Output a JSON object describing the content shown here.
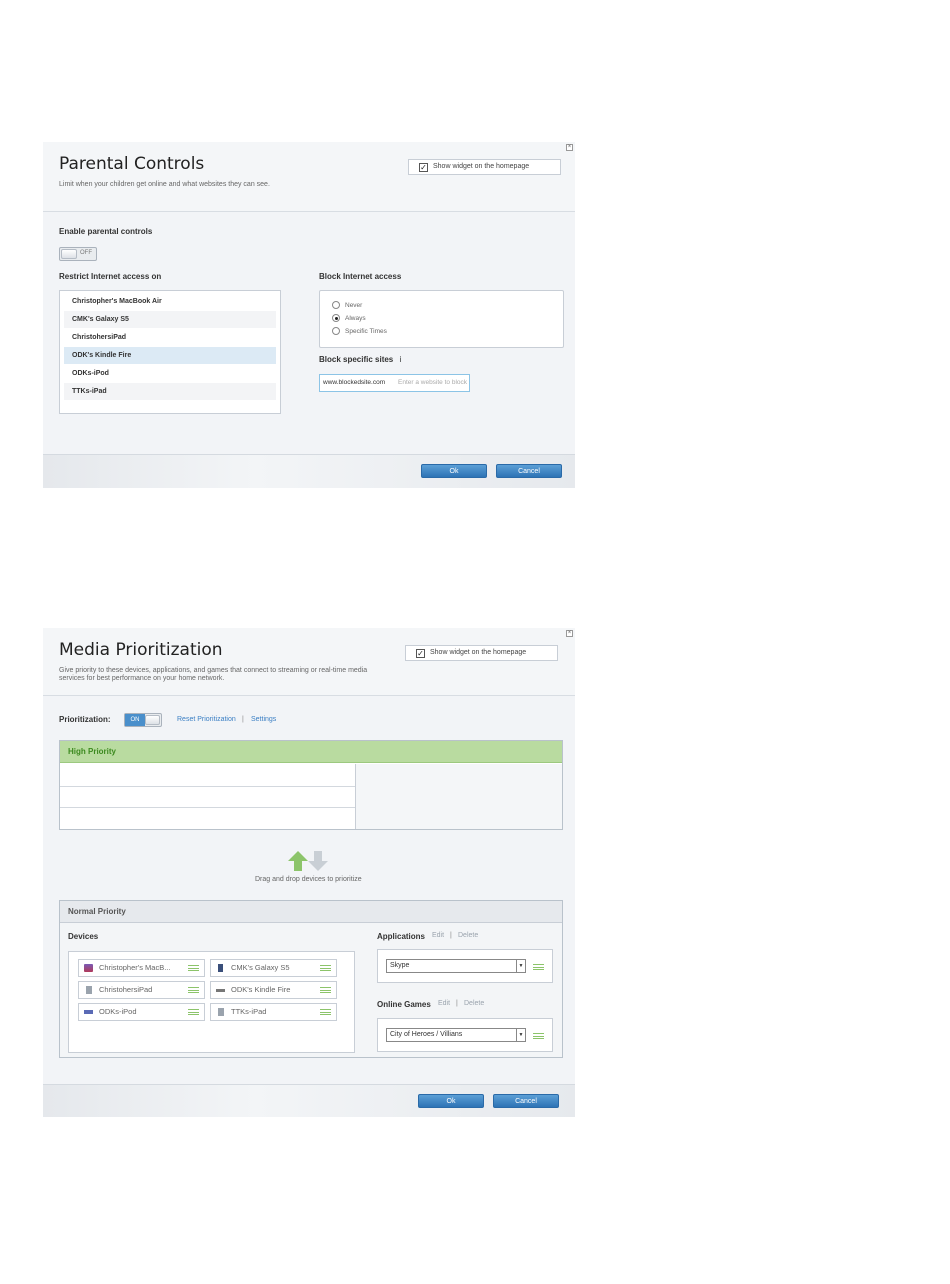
{
  "parental": {
    "title": "Parental Controls",
    "subtitle": "Limit when your children get online and what websites they can see.",
    "show_widget": "Show widget on the homepage",
    "enable_label": "Enable parental controls",
    "toggle_text": "OFF",
    "restrict_label": "Restrict Internet access on",
    "devices": [
      "Christopher's MacBook Air",
      "CMK's Galaxy S5",
      "ChristohersiPad",
      "ODK's Kindle Fire",
      "ODKs-iPod",
      "TTKs-iPad"
    ],
    "block_label": "Block Internet access",
    "block_options": [
      "Never",
      "Always",
      "Specific Times"
    ],
    "block_selected": "Always",
    "sites_label": "Block specific sites",
    "sites_info": "i",
    "site_value": "www.blockedsite.com",
    "site_placeholder": "Enter a website to block",
    "ok": "Ok",
    "cancel": "Cancel"
  },
  "media": {
    "title": "Media Prioritization",
    "subtitle_1": "Give priority to these devices, applications, and games that connect to streaming or real-time media",
    "subtitle_2": "services for best performance on your home network.",
    "show_widget": "Show widget on the homepage",
    "prio_label": "Prioritization:",
    "toggle_text": "ON",
    "reset": "Reset Prioritization",
    "sep": "|",
    "settings": "Settings",
    "high_priority": "High Priority",
    "drag_hint": "Drag and drop devices to prioritize",
    "normal_priority": "Normal Priority",
    "devices_label": "Devices",
    "devices": [
      "Christopher's MacB...",
      "CMK's Galaxy S5",
      "ChristohersiPad",
      "ODK's Kindle Fire",
      "ODKs-iPod",
      "TTKs-iPad"
    ],
    "applications_label": "Applications",
    "edit": "Edit",
    "delete": "Delete",
    "app_value": "Skype",
    "games_label": "Online Games",
    "game_value": "City of Heroes / Villians",
    "ok": "Ok",
    "cancel": "Cancel"
  },
  "colors": {
    "accent": "#3b7fc4",
    "high_priority_bg": "#b9dba0",
    "selected_row": "#dceaf5"
  }
}
